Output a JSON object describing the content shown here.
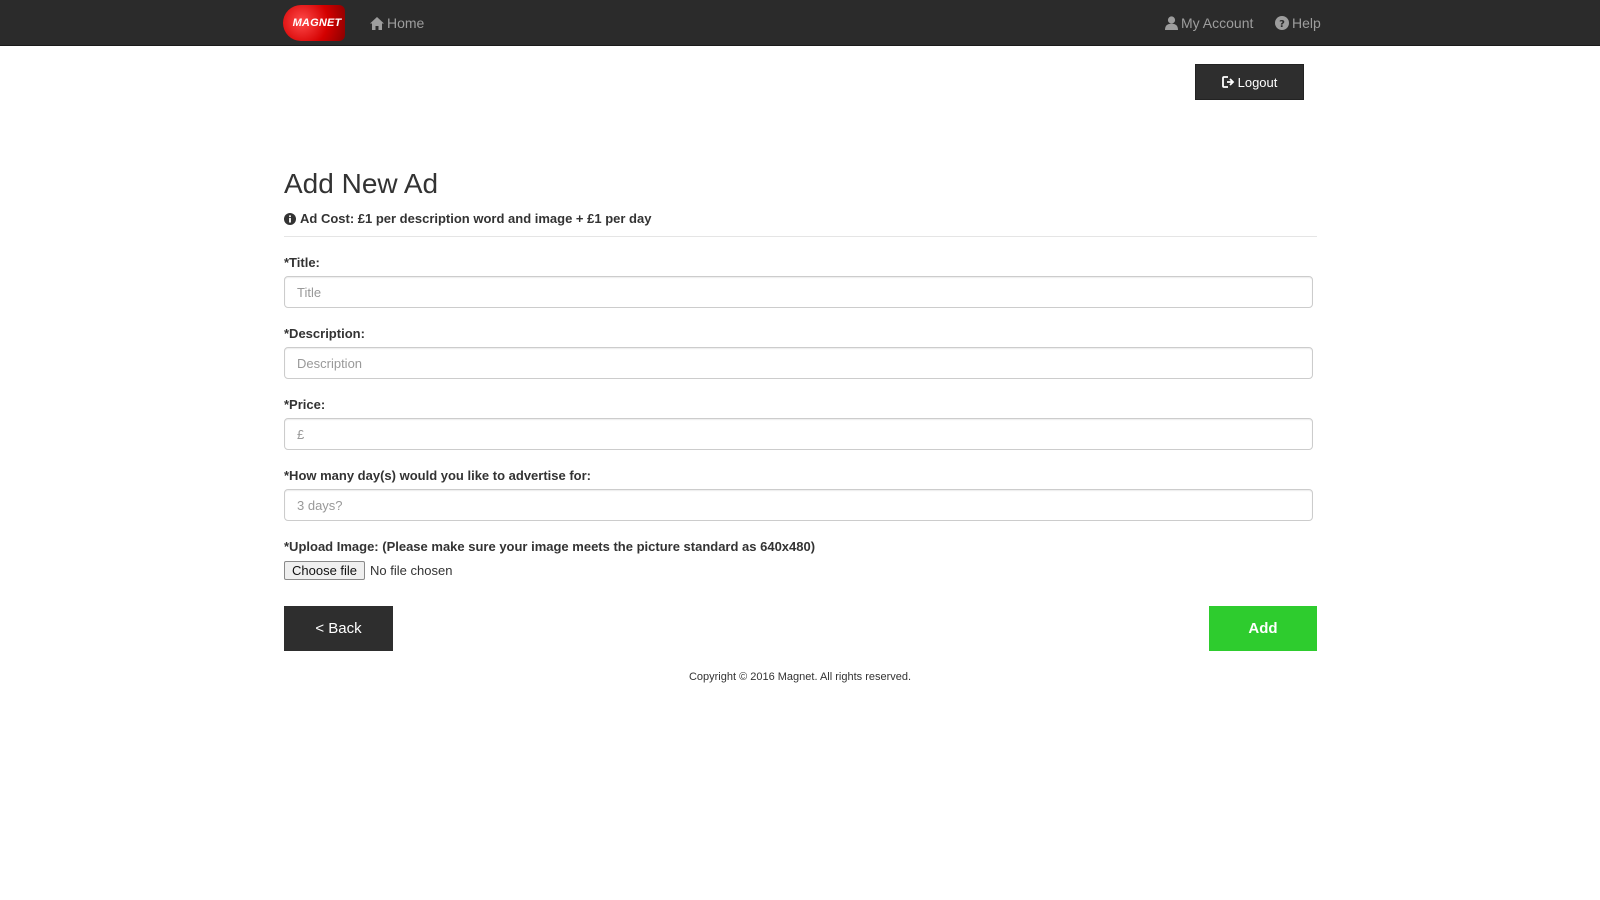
{
  "navbar": {
    "logo_text": "MAGNET",
    "home_label": "Home",
    "account_label": "My Account",
    "help_label": "Help"
  },
  "logout_label": "Logout",
  "page": {
    "title": "Add New Ad",
    "cost_note": "Ad Cost: £1 per description word and image + £1 per day"
  },
  "form": {
    "title": {
      "label": "*Title:",
      "placeholder": "Title"
    },
    "description": {
      "label": "*Description:",
      "placeholder": "Description"
    },
    "price": {
      "label": "*Price:",
      "placeholder": "£"
    },
    "days": {
      "label": "*How many day(s) would you like to advertise for:",
      "placeholder": "3 days?"
    },
    "upload": {
      "label": "*Upload Image: (Please make sure your image meets the picture standard as 640x480)",
      "button_label": "Choose file",
      "status": "No file chosen"
    }
  },
  "actions": {
    "back_label": "< Back",
    "add_label": "Add"
  },
  "footer": {
    "copyright": "Copyright © 2016 Magnet. All rights reserved."
  },
  "colors": {
    "navbar_bg": "#2b2b2b",
    "dark_button": "#2e2e2e",
    "add_button": "#2ecc2e",
    "logo_red": "#d40000"
  },
  "icons": {
    "home": "home-icon",
    "account": "user-icon",
    "help": "question-circle-icon",
    "logout": "sign-out-icon",
    "info": "info-circle-icon"
  }
}
